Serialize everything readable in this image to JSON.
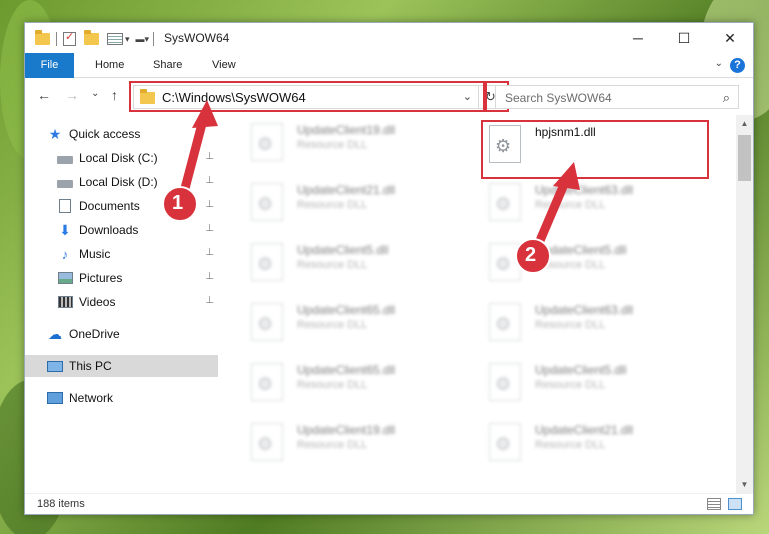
{
  "window": {
    "title": "SysWOW64",
    "controls": {
      "minimize": "─",
      "maximize": "☐",
      "close": "✕"
    }
  },
  "ribbon": {
    "tabs": [
      "File",
      "Home",
      "Share",
      "View"
    ],
    "help": "?",
    "expand": "⌄"
  },
  "navigation": {
    "back": "←",
    "forward": "→",
    "recent": "⌄",
    "up": "↑",
    "address": "C:\\Windows\\SysWOW64",
    "address_dropdown": "⌄",
    "refresh": "↻",
    "search_placeholder": "Search SysWOW64",
    "search_icon": "⌕"
  },
  "sidebar": {
    "items": [
      {
        "label": "Quick access",
        "icon": "star-icon",
        "pinned": false
      },
      {
        "label": "Local Disk (C:)",
        "icon": "disk-icon",
        "pinned": true
      },
      {
        "label": "Local Disk (D:)",
        "icon": "disk-icon",
        "pinned": true
      },
      {
        "label": "Documents",
        "icon": "document-icon",
        "pinned": true
      },
      {
        "label": "Downloads",
        "icon": "download-icon",
        "pinned": true
      },
      {
        "label": "Music",
        "icon": "music-icon",
        "pinned": true
      },
      {
        "label": "Pictures",
        "icon": "pictures-icon",
        "pinned": true
      },
      {
        "label": "Videos",
        "icon": "videos-icon",
        "pinned": true
      },
      {
        "label": "OneDrive",
        "icon": "cloud-icon",
        "pinned": false
      },
      {
        "label": "This PC",
        "icon": "computer-icon",
        "pinned": false,
        "selected": true
      },
      {
        "label": "Network",
        "icon": "network-icon",
        "pinned": false
      }
    ],
    "pin_glyph": "📌"
  },
  "files": {
    "left_column": [
      {
        "name": "UpdateClient19.dll",
        "type": "Resource DLL"
      },
      {
        "name": "UpdateClient21.dll",
        "type": "Resource DLL"
      },
      {
        "name": "UpdateClient5.dll",
        "type": "Resource DLL"
      },
      {
        "name": "UpdateClient65.dll",
        "type": "Resource DLL"
      },
      {
        "name": "UpdateClient65.dll",
        "type": "Resource DLL"
      },
      {
        "name": "UpdateClient19.dll",
        "type": "Resource DLL"
      }
    ],
    "right_column": [
      {
        "name": "hpjsnm1.dll",
        "type": ""
      },
      {
        "name": "UpdateClient63.dll",
        "type": "Resource DLL"
      },
      {
        "name": "UpdateClient5.dll",
        "type": "Resource DLL"
      },
      {
        "name": "UpdateClient63.dll",
        "type": "Resource DLL"
      },
      {
        "name": "UpdateClient5.dll",
        "type": "Resource DLL"
      },
      {
        "name": "UpdateClient21.dll",
        "type": "Resource DLL"
      }
    ]
  },
  "status": {
    "item_count": "188 items"
  },
  "annotations": {
    "step1": "1",
    "step2": "2",
    "highlight_color": "#d8323c"
  },
  "colors": {
    "file_tab": "#1979ca",
    "selected_nav": "#d9d9d9"
  }
}
